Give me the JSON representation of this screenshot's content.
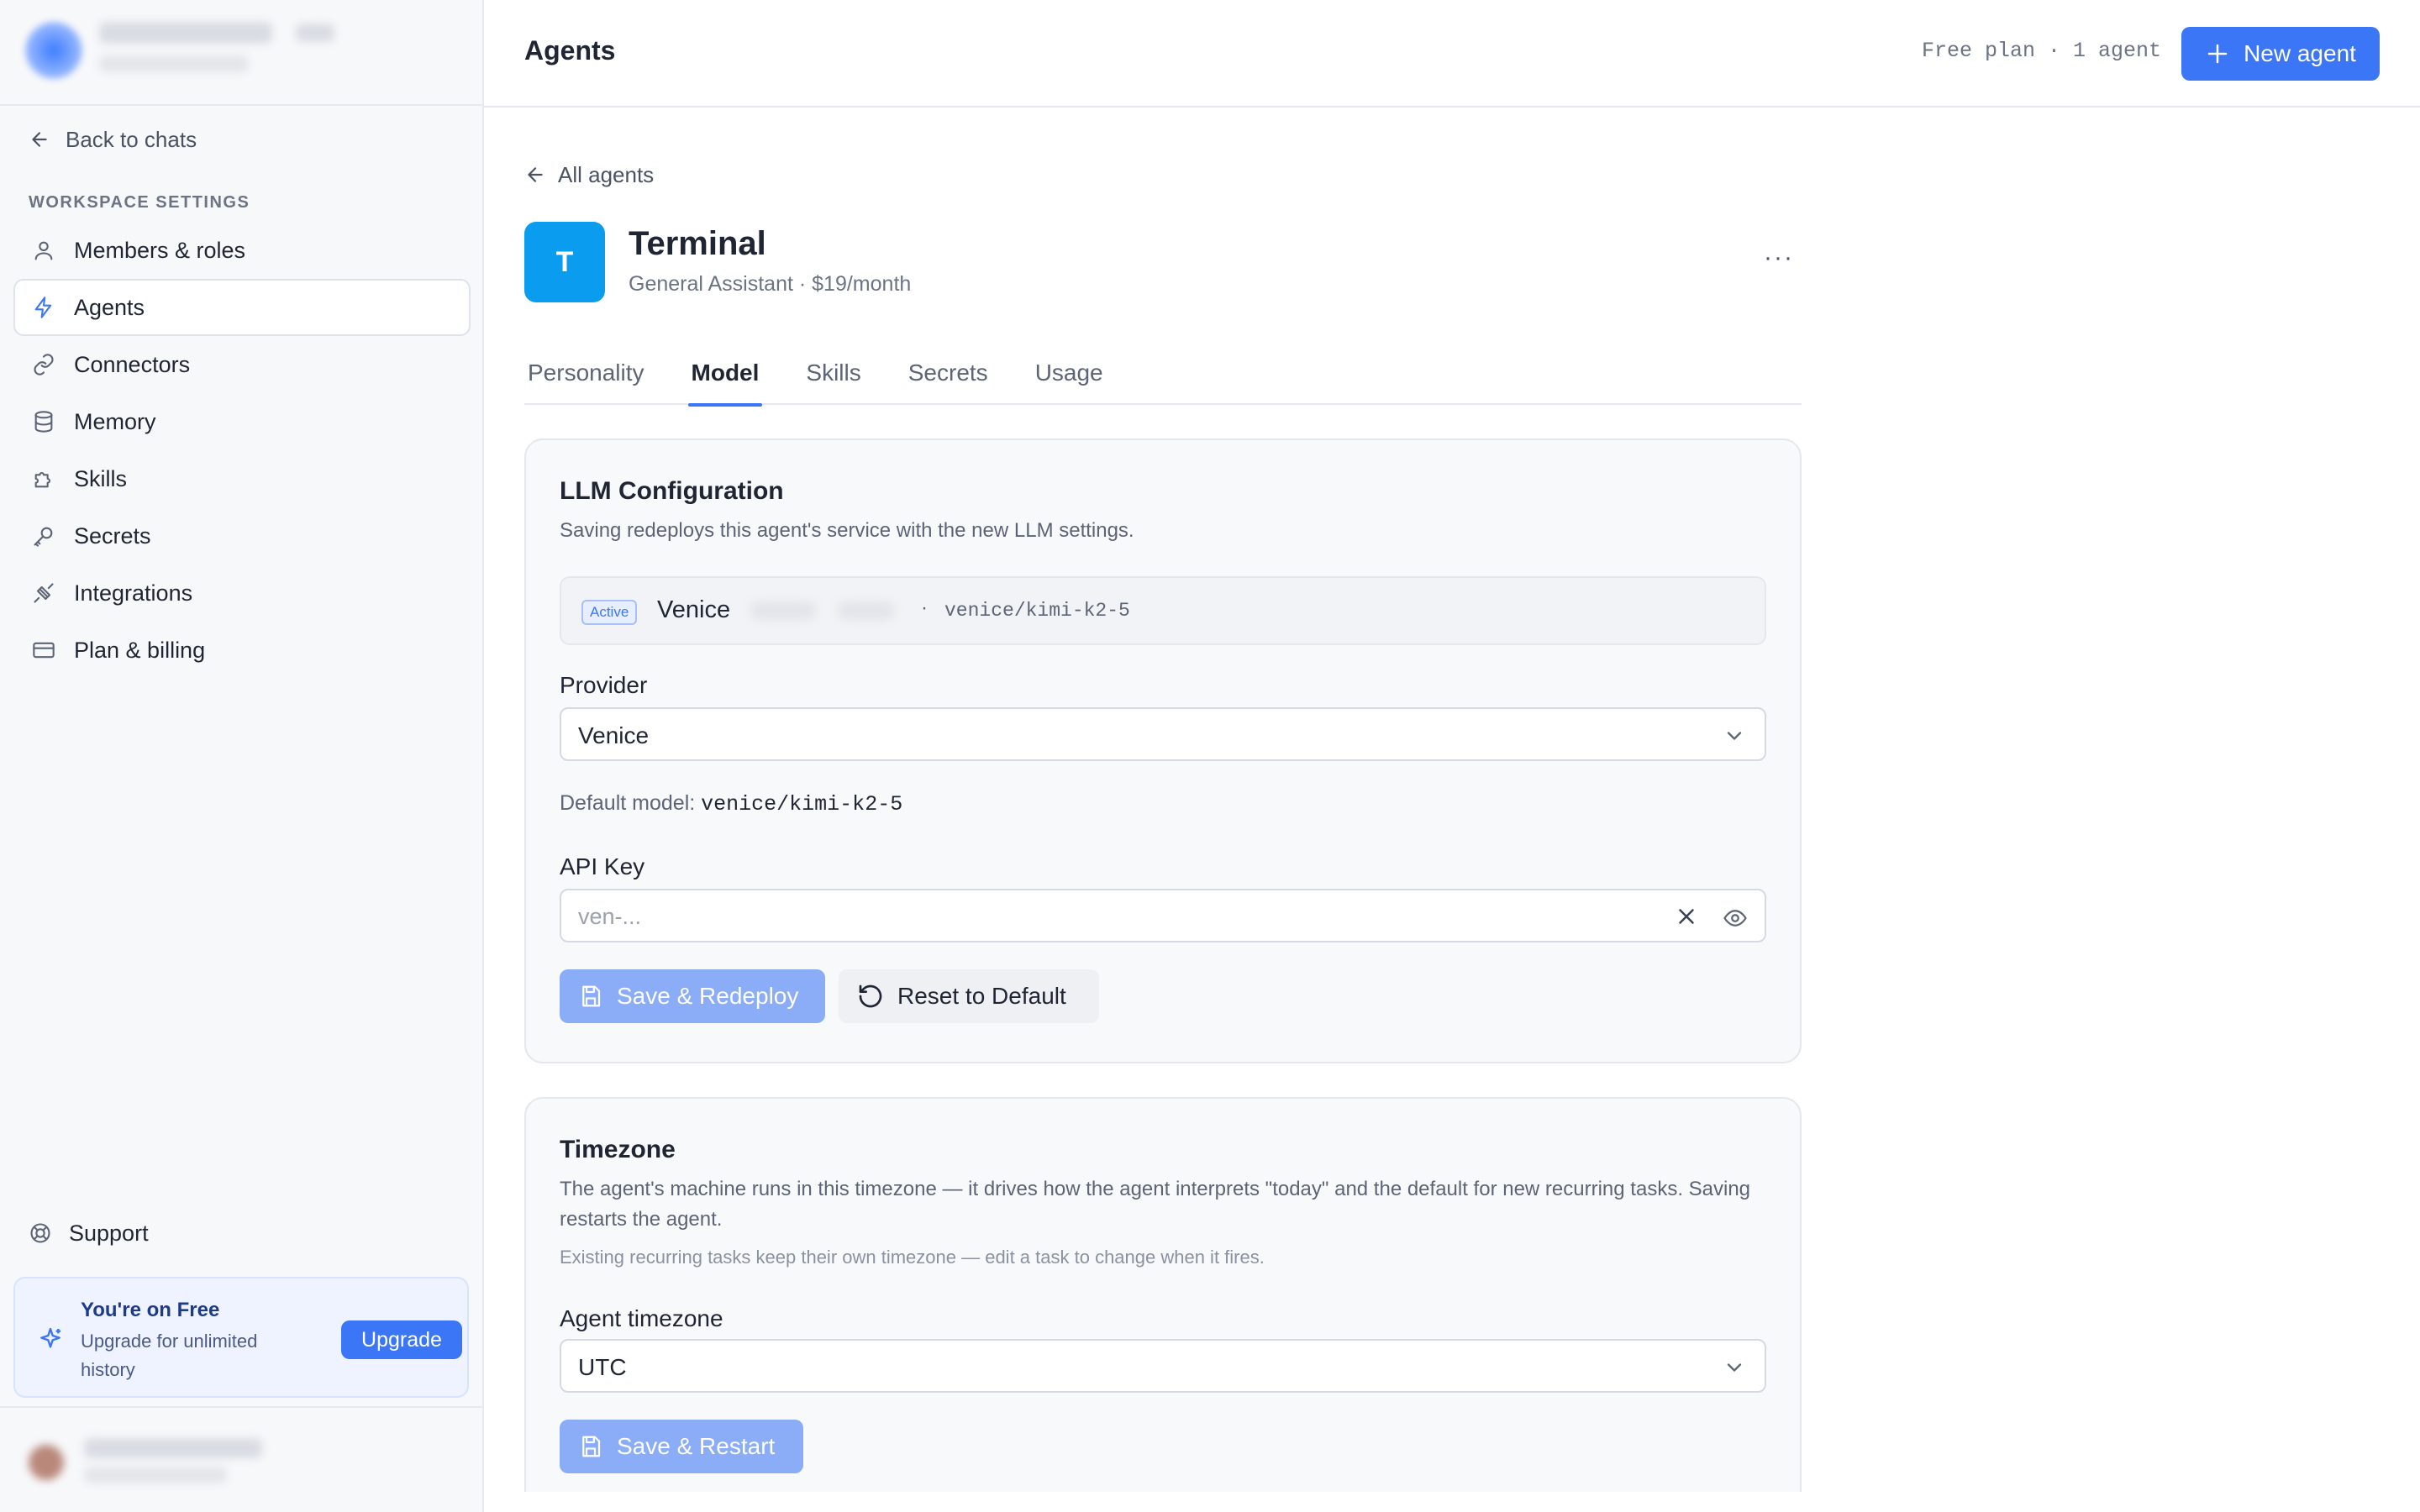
{
  "sidebar": {
    "back_label": "Back to chats",
    "section_label": "WORKSPACE SETTINGS",
    "items": [
      {
        "label": "Members & roles",
        "icon": "user-icon"
      },
      {
        "label": "Agents",
        "icon": "bolt-icon",
        "active": true
      },
      {
        "label": "Connectors",
        "icon": "link-icon"
      },
      {
        "label": "Memory",
        "icon": "database-icon"
      },
      {
        "label": "Skills",
        "icon": "puzzle-icon"
      },
      {
        "label": "Secrets",
        "icon": "key-icon"
      },
      {
        "label": "Integrations",
        "icon": "plug-icon"
      },
      {
        "label": "Plan & billing",
        "icon": "credit-card-icon"
      }
    ],
    "support_label": "Support",
    "plan_card": {
      "title": "You're on Free",
      "subtitle": "Upgrade for unlimited history",
      "button": "Upgrade"
    }
  },
  "header": {
    "title": "Agents",
    "plan_meta": "Free plan · 1 agent",
    "new_agent_label": "New agent"
  },
  "agent": {
    "back_label": "All agents",
    "initial": "T",
    "name": "Terminal",
    "subtitle": "General Assistant · $19/month",
    "more_label": "···",
    "tabs": [
      "Personality",
      "Model",
      "Skills",
      "Secrets",
      "Usage"
    ],
    "active_tab": "Model"
  },
  "llm": {
    "title": "LLM Configuration",
    "description": "Saving redeploys this agent's service with the new LLM settings.",
    "active_badge": "Active",
    "active_provider": "Venice",
    "active_sep": "·",
    "active_model": "venice/kimi-k2-5",
    "provider_label": "Provider",
    "provider_value": "Venice",
    "default_model_label": "Default model:",
    "default_model_value": "venice/kimi-k2-5",
    "api_key_label": "API Key",
    "api_key_placeholder": "ven-...",
    "save_label": "Save & Redeploy",
    "reset_label": "Reset to Default"
  },
  "timezone": {
    "title": "Timezone",
    "description": "The agent's machine runs in this timezone — it drives how the agent interprets \"today\" and the default for new recurring tasks. Saving restarts the agent.",
    "note": "Existing recurring tasks keep their own timezone — edit a task to change when it fires.",
    "field_label": "Agent timezone",
    "value": "UTC",
    "save_label": "Save & Restart"
  },
  "colors": {
    "accent": "#3b76f6",
    "agent_avatar": "#0a9cef",
    "disabled_primary": "#8bacf6"
  }
}
